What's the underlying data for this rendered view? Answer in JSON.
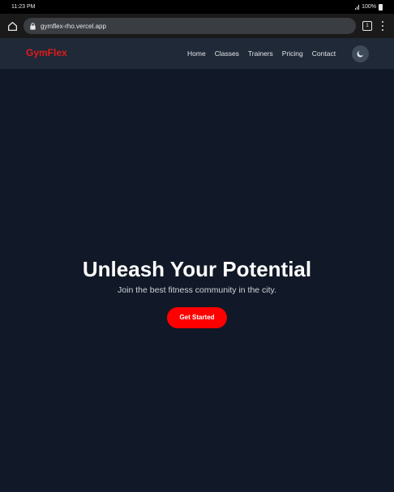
{
  "status_bar": {
    "time": "11:23 PM",
    "battery": "100%"
  },
  "browser": {
    "url": "gymflex-rho.vercel.app",
    "tab_count": "1"
  },
  "navbar": {
    "logo": "GymFlex",
    "links": [
      "Home",
      "Classes",
      "Trainers",
      "Pricing",
      "Contact"
    ],
    "theme_toggle_icon": "moon-icon"
  },
  "hero": {
    "title": "Unleash Your Potential",
    "subtitle": "Join the best fitness community in the city.",
    "cta_label": "Get Started"
  },
  "colors": {
    "page_background": "#111827",
    "navbar_background": "#1f2937",
    "brand_red": "#e01b1b",
    "cta_red": "#ff0000"
  }
}
